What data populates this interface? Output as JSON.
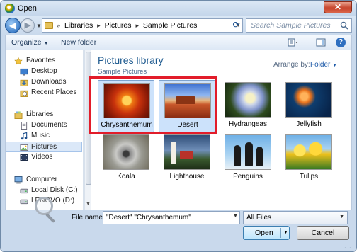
{
  "window": {
    "title": "Open",
    "close_label": "✕"
  },
  "address": {
    "crumbs": [
      "Libraries",
      "Pictures",
      "Sample Pictures"
    ],
    "search_placeholder": "Search Sample Pictures"
  },
  "toolbar": {
    "organize": "Organize",
    "new_folder": "New folder"
  },
  "nav": {
    "items": [
      {
        "label": "Favorites",
        "icon": "star-icon",
        "level": "header"
      },
      {
        "label": "Desktop",
        "icon": "desktop-icon",
        "level": "child"
      },
      {
        "label": "Downloads",
        "icon": "downloads-icon",
        "level": "child"
      },
      {
        "label": "Recent Places",
        "icon": "recent-places-icon",
        "level": "child"
      },
      {
        "label": "Libraries",
        "icon": "libraries-icon",
        "level": "header"
      },
      {
        "label": "Documents",
        "icon": "documents-icon",
        "level": "child"
      },
      {
        "label": "Music",
        "icon": "music-icon",
        "level": "child"
      },
      {
        "label": "Pictures",
        "icon": "pictures-icon",
        "level": "child",
        "selected": true
      },
      {
        "label": "Videos",
        "icon": "videos-icon",
        "level": "child"
      },
      {
        "label": "Computer",
        "icon": "computer-icon",
        "level": "header"
      },
      {
        "label": "Local Disk (C:)",
        "icon": "disk-icon",
        "level": "child"
      },
      {
        "label": "LENOVO (D:)",
        "icon": "disk-icon",
        "level": "child"
      }
    ]
  },
  "library": {
    "title": "Pictures library",
    "subtitle": "Sample Pictures",
    "arrange_label": "Arrange by:",
    "arrange_value": "Folder"
  },
  "files": [
    {
      "name": "Chrysanthemum",
      "selected": true
    },
    {
      "name": "Desert",
      "selected": true
    },
    {
      "name": "Hydrangeas",
      "selected": false
    },
    {
      "name": "Jellyfish",
      "selected": false
    },
    {
      "name": "Koala",
      "selected": false
    },
    {
      "name": "Lighthouse",
      "selected": false
    },
    {
      "name": "Penguins",
      "selected": false
    },
    {
      "name": "Tulips",
      "selected": false
    }
  ],
  "footer": {
    "filename_label": "File name:",
    "filename_value": "\"Desert\" \"Chrysanthemum\"",
    "filter_value": "All Files",
    "open_label": "Open",
    "cancel_label": "Cancel"
  },
  "colors": {
    "highlight": "#e21c2a",
    "selection": "#cce2fb",
    "library_title": "#1e5a8f"
  }
}
